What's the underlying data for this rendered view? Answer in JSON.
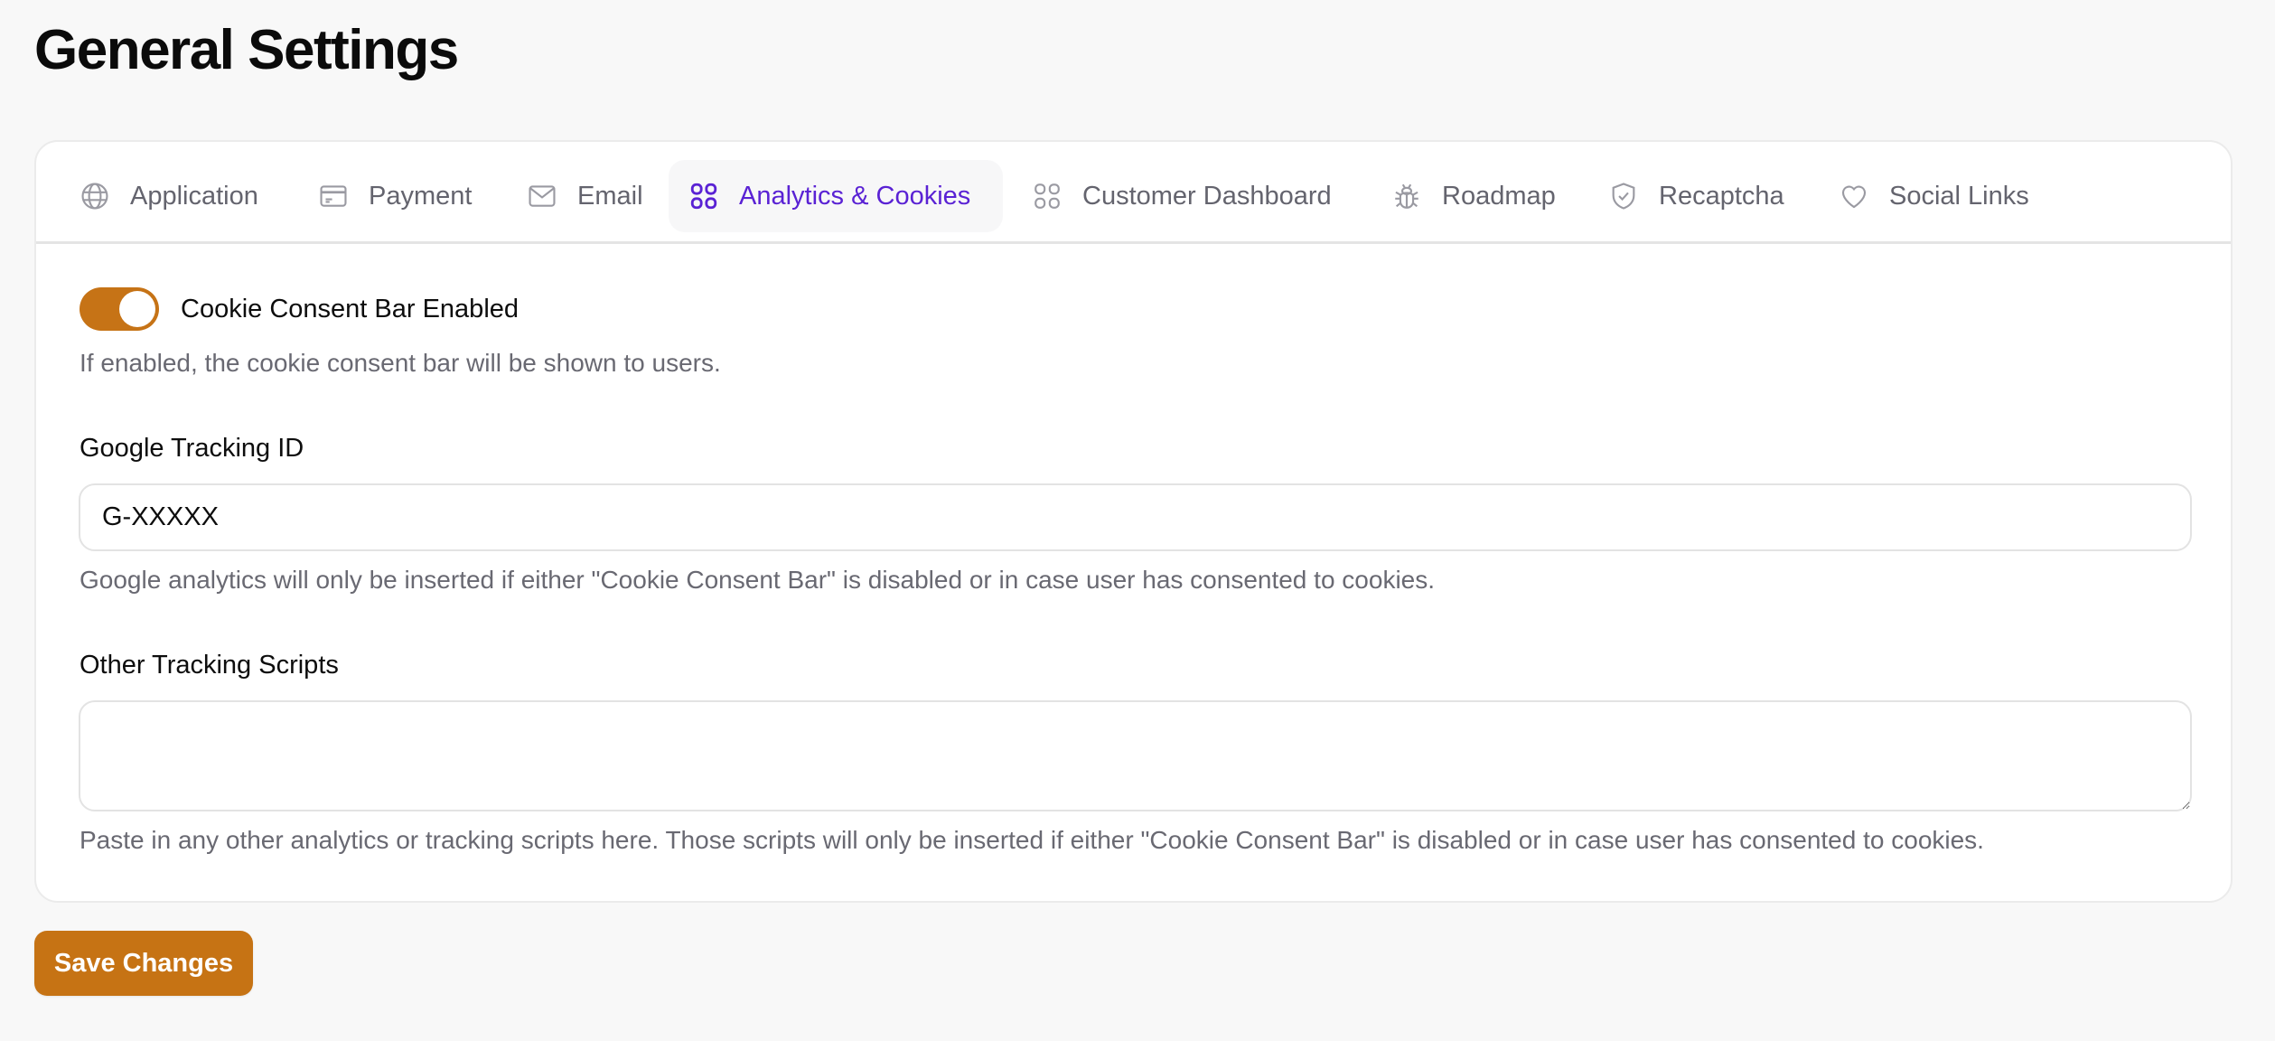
{
  "page": {
    "title": "General Settings"
  },
  "tabs": [
    {
      "label": "Application",
      "icon": "globe-icon",
      "active": false
    },
    {
      "label": "Payment",
      "icon": "credit-card-icon",
      "active": false
    },
    {
      "label": "Email",
      "icon": "mail-icon",
      "active": false
    },
    {
      "label": "Analytics & Cookies",
      "icon": "grid-icon",
      "active": true
    },
    {
      "label": "Customer Dashboard",
      "icon": "grid-icon",
      "active": false
    },
    {
      "label": "Roadmap",
      "icon": "bug-icon",
      "active": false
    },
    {
      "label": "Recaptcha",
      "icon": "shield-check-icon",
      "active": false
    },
    {
      "label": "Social Links",
      "icon": "heart-icon",
      "active": false
    }
  ],
  "cookie_consent": {
    "label": "Cookie Consent Bar Enabled",
    "enabled": true,
    "help": "If enabled, the cookie consent bar will be shown to users."
  },
  "google_tracking": {
    "label": "Google Tracking ID",
    "value": "G-XXXXX",
    "help": "Google analytics will only be inserted if either \"Cookie Consent Bar\" is disabled or in case user has consented to cookies."
  },
  "other_scripts": {
    "label": "Other Tracking Scripts",
    "value": "",
    "help": "Paste in any other analytics or tracking scripts here. Those scripts will only be inserted if either \"Cookie Consent Bar\" is disabled or in case user has consented to cookies."
  },
  "actions": {
    "save_label": "Save Changes"
  },
  "colors": {
    "accent": "#c67314",
    "active_tab": "#5a22d4",
    "muted_text": "#696972",
    "background": "#f8f8f8"
  }
}
